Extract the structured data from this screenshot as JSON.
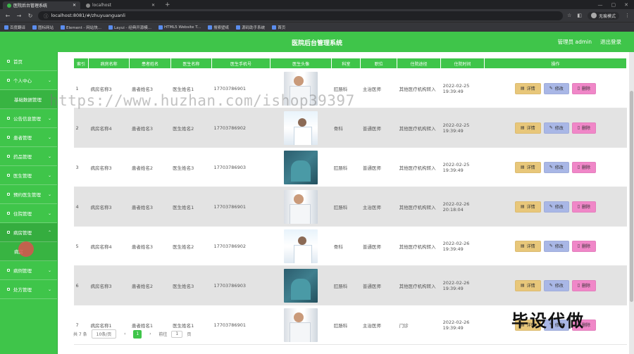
{
  "browser": {
    "tabs": [
      {
        "title": "医院后台管理系统",
        "active": true
      },
      {
        "title": "localhost",
        "active": false
      }
    ],
    "url": "localhost:8081/#/zhuyuanguanli",
    "profile_label": "无痕模式",
    "bookmarks": [
      "百度翻译",
      "图标网站",
      "Element - 网站快...",
      "Layui - 经典开源模...",
      "HTML5 Website T...",
      "搜索壁纸",
      "源码助手系统",
      "首页"
    ]
  },
  "header": {
    "title": "医院后台管理系统",
    "admin_label": "管理员 admin",
    "logout_label": "退出登录"
  },
  "sidebar": {
    "items": [
      {
        "label": "首页",
        "chevron": false,
        "type": "top"
      },
      {
        "label": "个人中心",
        "chevron": true,
        "type": "top"
      },
      {
        "label": "基础数据管理",
        "chevron": false,
        "type": "sub"
      },
      {
        "label": "公告信息管理",
        "chevron": true,
        "type": "top"
      },
      {
        "label": "患者管理",
        "chevron": true,
        "type": "top"
      },
      {
        "label": "药品管理",
        "chevron": true,
        "type": "top"
      },
      {
        "label": "医生管理",
        "chevron": true,
        "type": "top"
      },
      {
        "label": "预约医生管理",
        "chevron": true,
        "type": "top"
      },
      {
        "label": "住院管理",
        "chevron": true,
        "type": "top"
      },
      {
        "label": "病房管理",
        "chevron": true,
        "type": "open"
      },
      {
        "label": "病房",
        "chevron": false,
        "type": "sub"
      },
      {
        "label": "病例管理",
        "chevron": true,
        "type": "top"
      },
      {
        "label": "处方管理",
        "chevron": true,
        "type": "top"
      }
    ]
  },
  "table": {
    "headers": [
      "索引",
      "病房名称",
      "患者姓名",
      "医生名称",
      "医生手机号",
      "医生头像",
      "科室",
      "职位",
      "住院途径",
      "住院时间",
      "操作"
    ],
    "rows": [
      {
        "index": "1",
        "ward": "病房名称3",
        "patient": "患者姓名3",
        "doctor": "医生姓名1",
        "phone": "17703786901",
        "avatar": "v1",
        "dept": "肛肠科",
        "title": "主治医师",
        "route": "其他医疗机构转入",
        "time": "2022-02-25 19:39:49"
      },
      {
        "index": "2",
        "ward": "病房名称4",
        "patient": "患者姓名3",
        "doctor": "医生姓名2",
        "phone": "17703786902",
        "avatar": "v2",
        "dept": "骨科",
        "title": "普通医师",
        "route": "其他医疗机构转入",
        "time": "2022-02-25 19:39:49"
      },
      {
        "index": "3",
        "ward": "病房名称3",
        "patient": "患者姓名2",
        "doctor": "医生姓名3",
        "phone": "17703786903",
        "avatar": "v3",
        "dept": "肛肠科",
        "title": "普通医师",
        "route": "其他医疗机构转入",
        "time": "2022-02-25 19:39:49"
      },
      {
        "index": "4",
        "ward": "病房名称3",
        "patient": "患者姓名3",
        "doctor": "医生姓名1",
        "phone": "17703786901",
        "avatar": "v1",
        "dept": "肛肠科",
        "title": "主治医师",
        "route": "其他医疗机构转入",
        "time": "2022-02-26 20:18:04"
      },
      {
        "index": "5",
        "ward": "病房名称4",
        "patient": "患者姓名3",
        "doctor": "医生姓名2",
        "phone": "17703786902",
        "avatar": "v2",
        "dept": "骨科",
        "title": "普通医师",
        "route": "其他医疗机构转入",
        "time": "2022-02-26 19:39:49"
      },
      {
        "index": "6",
        "ward": "病房名称3",
        "patient": "患者姓名2",
        "doctor": "医生姓名3",
        "phone": "17703786903",
        "avatar": "v3",
        "dept": "肛肠科",
        "title": "普通医师",
        "route": "其他医疗机构转入",
        "time": "2022-02-26 19:39:49"
      },
      {
        "index": "7",
        "ward": "病房名称1",
        "patient": "患者姓名1",
        "doctor": "医生姓名1",
        "phone": "17703786901",
        "avatar": "v1",
        "dept": "肛肠科",
        "title": "主治医师",
        "route": "门诊",
        "time": "2022-02-26 19:39:49"
      }
    ],
    "actions": {
      "detail": "详情",
      "edit": "修改",
      "delete": "删除"
    }
  },
  "pagination": {
    "total_label": "共 7 条",
    "page_size_label": "10条/页",
    "current_page": "1",
    "prev": "‹",
    "next": "›",
    "goto_label": "前往",
    "goto_value": "1",
    "page_suffix": "页"
  },
  "overlays": {
    "watermark": "https://www.huzhan.com/ishop39397",
    "corner_text": "毕设代做"
  },
  "colors": {
    "primary": "#3fc54a",
    "detail": "#e8c77a",
    "edit": "#a9b7e6",
    "delete": "#f087c8"
  }
}
